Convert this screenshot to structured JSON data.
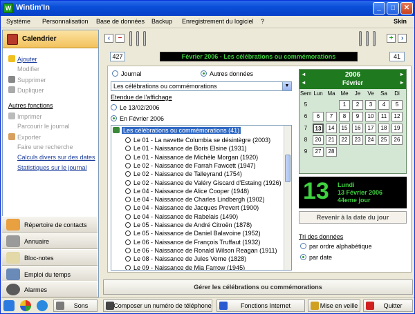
{
  "window": {
    "title": "Wintim'In",
    "app_icon": "W",
    "skin": "Skin"
  },
  "menu": [
    "Système",
    "Personnalisation",
    "Base de données",
    "Backup",
    "Enregistrement du logiciel",
    "?"
  ],
  "sidebar": {
    "title": "Calendrier",
    "actions": [
      "Ajouter",
      "Modifier",
      "Supprimer",
      "Dupliquer"
    ],
    "other_title": "Autres fonctions",
    "other": [
      "Imprimer",
      "Parcourir le journal",
      "Exporter",
      "Faire une recherche",
      "Calculs divers sur des dates",
      "Statistiques sur le journal"
    ],
    "nav": [
      "Répertoire de contacts",
      "Annuaire",
      "Bloc-notes",
      "Emploi du temps",
      "Alarmes"
    ]
  },
  "main": {
    "page_left": "427",
    "page_right": "41",
    "banner": "Février 2006 - Les célébrations ou commémorations",
    "radio_journal": "Journal",
    "radio_autres": "Autres données",
    "combo": "Les célébrations ou commémorations",
    "etendue": "Etendue de l'affichage",
    "opt_day": "Le 13/02/2006",
    "opt_month": "En Février 2006",
    "tree_root": "Les célébrations ou commémorations (41)",
    "events": [
      "Le 01 - La navette Columbia se désintègre  (2003)",
      "Le 01 - Naissance de Boris Elsine (1931)",
      "Le 01 - Naissance de Michèle Morgan (1920)",
      "Le 02 - Naissance de Farrah Fawcett (1947)",
      "Le 02 - Naissance de Talleyrand (1754)",
      "Le 02 - Naissance de Valéry Giscard d'Estaing (1926)",
      "Le 04 - Naissance de Alice Cooper (1948)",
      "Le 04 - Naissance de Charles Lindbergh (1902)",
      "Le 04 - Naissance de Jacques Prevert (1900)",
      "Le 04 - Naissance de Rabelais (1490)",
      "Le 05 - Naissance de André Citroën (1878)",
      "Le 05 - Naissance de Daniel Balavoine (1952)",
      "Le 06 - Naissance de François Truffaut (1932)",
      "Le 06 - Naissance de Ronald Wilson Reagan (1911)",
      "Le 08 - Naissance de Jules Verne (1828)",
      "Le 09 - Naissance de Mia Farrow (1945)"
    ],
    "tri_title": "Tri des données",
    "tri_alpha": "par ordre alphabétique",
    "tri_date": "par date",
    "gerer": "Gérer les célébrations ou commémorations"
  },
  "calendar": {
    "year": "2006",
    "month": "Février",
    "days": [
      "Sem",
      "Lun",
      "Ma",
      "Me",
      "Je",
      "Ve",
      "Sa",
      "Di"
    ],
    "weeks": [
      {
        "w": "5",
        "d": [
          "",
          "",
          "1",
          "2",
          "3",
          "4",
          "5"
        ]
      },
      {
        "w": "6",
        "d": [
          "6",
          "7",
          "8",
          "9",
          "10",
          "11",
          "12"
        ]
      },
      {
        "w": "7",
        "d": [
          "13",
          "14",
          "15",
          "16",
          "17",
          "18",
          "19"
        ]
      },
      {
        "w": "8",
        "d": [
          "20",
          "21",
          "22",
          "23",
          "24",
          "25",
          "26"
        ]
      },
      {
        "w": "9",
        "d": [
          "27",
          "28",
          "",
          "",
          "",
          "",
          ""
        ]
      }
    ],
    "big_day": "13",
    "day_name": "Lundi",
    "full_date": "13 Février 2006",
    "day_num": "44eme jour",
    "today_button": "Revenir à la date du jour"
  },
  "bottom": {
    "sons": "Sons",
    "phone": "Composer un numéro de téléphone",
    "internet": "Fonctions Internet",
    "veille": "Mise en veille",
    "quit": "Quitter"
  }
}
